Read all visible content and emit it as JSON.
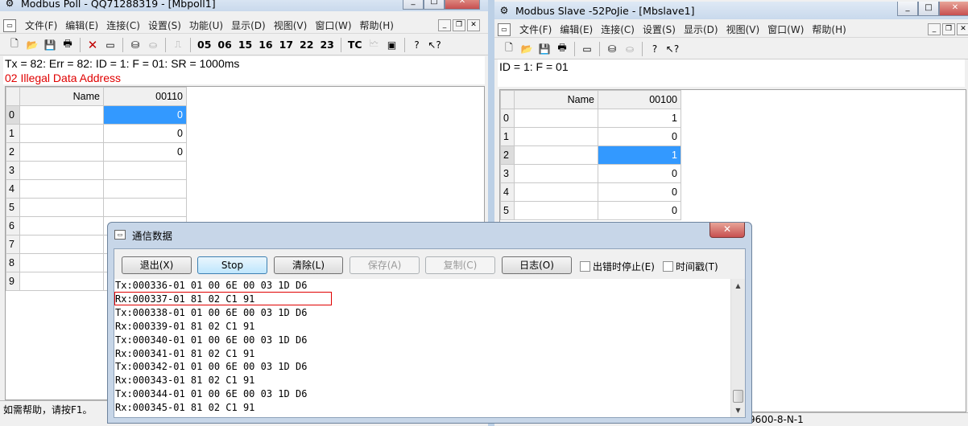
{
  "poll": {
    "title": "Modbus Poll - QQ71288319 - [Mbpoll1]",
    "menu": [
      "文件(F)",
      "编辑(E)",
      "连接(C)",
      "设置(S)",
      "功能(U)",
      "显示(D)",
      "视图(V)",
      "窗口(W)",
      "帮助(H)"
    ],
    "function_codes": [
      "05",
      "06",
      "15",
      "16",
      "17",
      "22",
      "23"
    ],
    "tc_label": "TC",
    "status_line": "Tx = 82: Err = 82: ID = 1: F = 01: SR = 1000ms",
    "error_line": "02 Illegal Data Address",
    "grid": {
      "name_header": "Name",
      "address_header": "00110",
      "rows": [
        {
          "index": "0",
          "value": "0"
        },
        {
          "index": "1",
          "value": "0"
        },
        {
          "index": "2",
          "value": "0"
        },
        {
          "index": "3",
          "value": ""
        },
        {
          "index": "4",
          "value": ""
        },
        {
          "index": "5",
          "value": ""
        },
        {
          "index": "6",
          "value": ""
        },
        {
          "index": "7",
          "value": ""
        },
        {
          "index": "8",
          "value": ""
        },
        {
          "index": "9",
          "value": ""
        }
      ]
    },
    "status_bar": "如需帮助，请按F1。"
  },
  "slave": {
    "title": "Modbus Slave -52PoJie - [Mbslave1]",
    "menu": [
      "文件(F)",
      "编辑(E)",
      "连接(C)",
      "设置(S)",
      "显示(D)",
      "视图(V)",
      "窗口(W)",
      "帮助(H)"
    ],
    "status_line": "ID = 1: F = 01",
    "grid": {
      "name_header": "Name",
      "address_header": "00100",
      "rows": [
        {
          "index": "0",
          "value": "1"
        },
        {
          "index": "1",
          "value": "0"
        },
        {
          "index": "2",
          "value": "1"
        },
        {
          "index": "3",
          "value": "0"
        },
        {
          "index": "4",
          "value": "0"
        },
        {
          "index": "5",
          "value": "0"
        }
      ]
    },
    "status_bar": "9600-8-N-1"
  },
  "dialog": {
    "title": "通信数据",
    "buttons": {
      "exit": "退出(X)",
      "stop": "Stop",
      "clear": "清除(L)",
      "save": "保存(A)",
      "copy": "复制(C)",
      "log": "日志(O)"
    },
    "checkboxes": {
      "stop_on_error": "出错时停止(E)",
      "timestamp": "时间戳(T)"
    },
    "log_lines": [
      "Tx:000336-01 01 00 6E 00 03 1D D6",
      "Rx:000337-01 81 02 C1 91",
      "Tx:000338-01 01 00 6E 00 03 1D D6",
      "Rx:000339-01 81 02 C1 91",
      "Tx:000340-01 01 00 6E 00 03 1D D6",
      "Rx:000341-01 81 02 C1 91",
      "Tx:000342-01 01 00 6E 00 03 1D D6",
      "Rx:000343-01 81 02 C1 91",
      "Tx:000344-01 01 00 6E 00 03 1D D6",
      "Rx:000345-01 81 02 C1 91"
    ]
  },
  "colors": {
    "selection": "#3399ff",
    "error_text": "#e00000",
    "highlight_box": "#e00000"
  }
}
